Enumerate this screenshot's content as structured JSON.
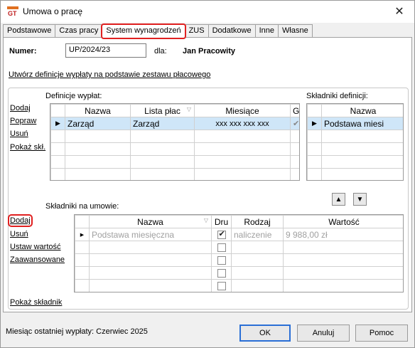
{
  "window": {
    "title": "Umowa o pracę",
    "app_icon": "gt-logo-icon",
    "close_glyph": "✕"
  },
  "tabs": [
    {
      "label": "Podstawowe"
    },
    {
      "label": "Czas pracy"
    },
    {
      "label": "System wynagrodzeń"
    },
    {
      "label": "ZUS"
    },
    {
      "label": "Dodatkowe"
    },
    {
      "label": "Inne"
    },
    {
      "label": "Własne"
    }
  ],
  "header": {
    "numer_label": "Numer:",
    "numer_value": "UP/2024/23",
    "dla_label": "dla:",
    "employee": "Jan Pracowity"
  },
  "create_link": "Utwórz definicje wypłaty na podstawie zestawu płacowego",
  "definitions": {
    "label": "Definicje wypłat:",
    "actions": [
      "Dodaj",
      "Popraw",
      "Usuń",
      "Pokaż skł."
    ],
    "columns": [
      "Nazwa",
      "Lista płac",
      "Miesiące",
      "G"
    ],
    "rows": [
      {
        "nazwa": "Zarząd",
        "lista": "Zarząd",
        "miesiace": "xxx xxx xxx xxx",
        "g": true
      }
    ]
  },
  "components_def": {
    "label": "Składniki definicji:",
    "columns": [
      "Nazwa"
    ],
    "rows": [
      {
        "nazwa": "Podstawa miesi"
      }
    ]
  },
  "contract_components": {
    "label": "Składniki na umowie:",
    "actions": [
      "Dodaj",
      "Usuń",
      "Ustaw wartość",
      "Zaawansowane"
    ],
    "columns": [
      "Nazwa",
      "Dru",
      "Rodzaj",
      "Wartość"
    ],
    "rows": [
      {
        "nazwa": "Podstawa miesięczna",
        "dru": true,
        "rodzaj": "naliczenie",
        "wartosc": "9 988,00 zł"
      }
    ],
    "show_link": "Pokaż składnik"
  },
  "status": {
    "last_payment": "Miesiąc ostatniej wypłaty: Czerwiec 2025",
    "ok": "OK",
    "cancel": "Anuluj",
    "help": "Pomoc"
  },
  "colors": {
    "selection": "#cfe6f8",
    "highlight": "#e02020",
    "default_button": "#2a6fd6"
  }
}
